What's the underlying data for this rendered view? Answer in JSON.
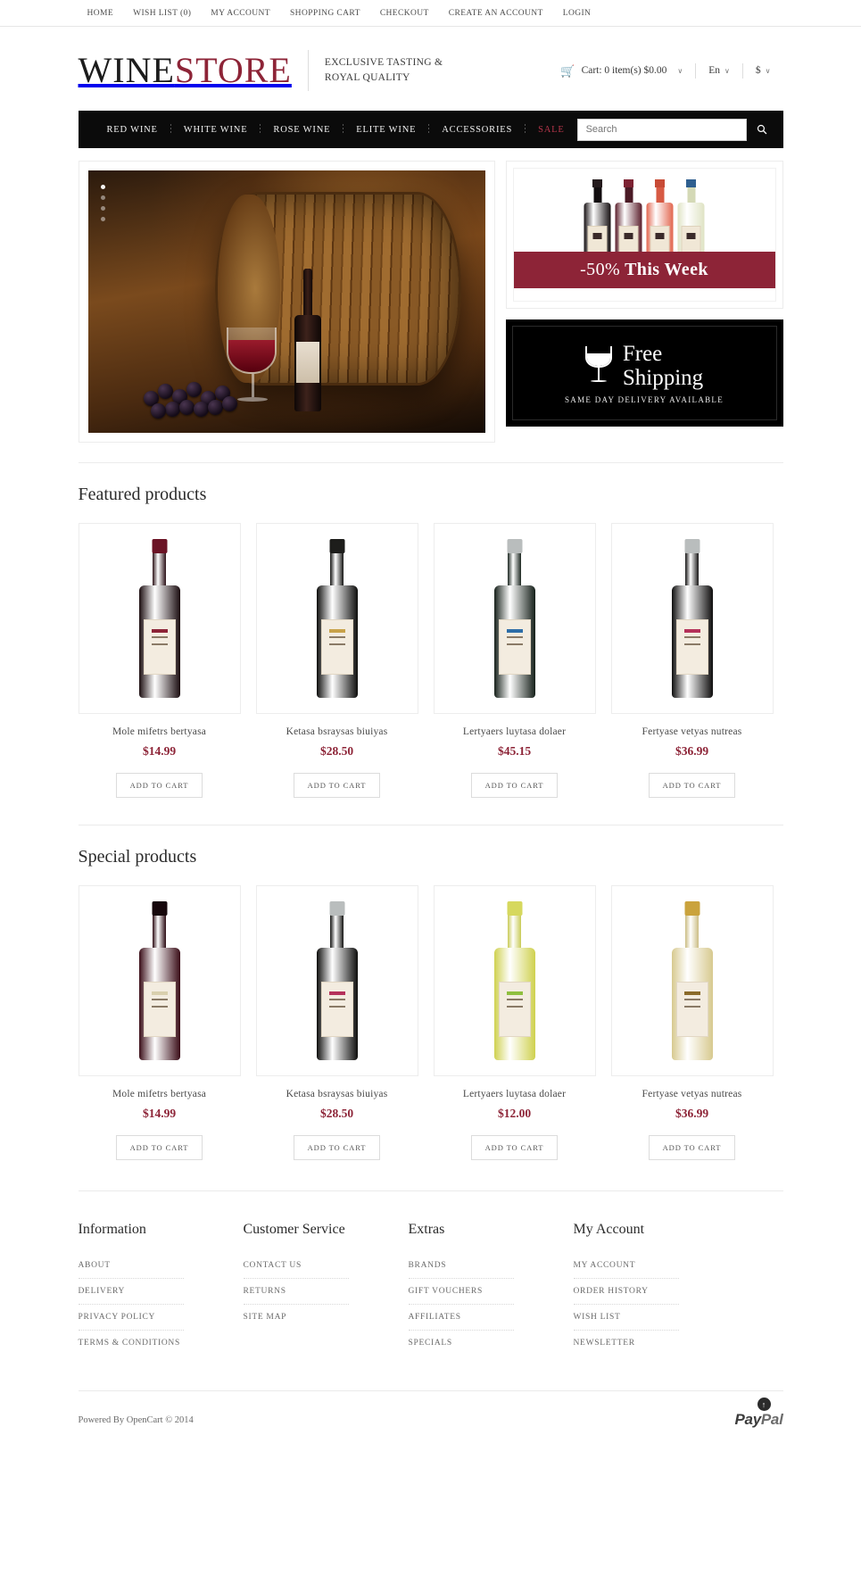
{
  "topnav": {
    "items": [
      {
        "label": "HOME",
        "name": "topnav-home"
      },
      {
        "label": "WISH LIST (0)",
        "name": "topnav-wish-list"
      },
      {
        "label": "MY ACCOUNT",
        "name": "topnav-my-account"
      },
      {
        "label": "SHOPPING CART",
        "name": "topnav-shopping-cart"
      },
      {
        "label": "CHECKOUT",
        "name": "topnav-checkout"
      },
      {
        "label": "CREATE AN ACCOUNT",
        "name": "topnav-create-an-account"
      },
      {
        "label": "LOGIN",
        "name": "topnav-login"
      }
    ]
  },
  "header": {
    "logo_part1": "WINE",
    "logo_part2": "STORE",
    "tagline_line1": "EXCLUSIVE TASTING &",
    "tagline_line2": "ROYAL QUALITY",
    "cart_text": "Cart: 0 item(s) $0.00",
    "cart_icon": "cart-icon",
    "language": "En",
    "currency": "$",
    "caret": "∨"
  },
  "nav": {
    "items": [
      {
        "label": "RED WINE",
        "name": "nav-red-wine",
        "sale": false
      },
      {
        "label": "WHITE WINE",
        "name": "nav-white-wine",
        "sale": false
      },
      {
        "label": "ROSE WINE",
        "name": "nav-rose-wine",
        "sale": false
      },
      {
        "label": "ELITE WINE",
        "name": "nav-elite-wine",
        "sale": false
      },
      {
        "label": "ACCESSORIES",
        "name": "nav-accessories",
        "sale": false
      },
      {
        "label": "SALE",
        "name": "nav-sale",
        "sale": true
      }
    ],
    "search_placeholder": "Search",
    "search_value": "",
    "search_icon": "search-icon"
  },
  "hero": {
    "slide_alt": "wine barrel with glass and bottle",
    "dots": 4,
    "active_dot": 0
  },
  "banners": {
    "promo": {
      "discount": "-50%",
      "text": " This Week"
    },
    "shipping": {
      "line1": "Free",
      "line2": "Shipping",
      "sub": "SAME DAY DELIVERY AVAILABLE",
      "icon": "wine-glass-icon"
    }
  },
  "featured": {
    "title": "Featured products",
    "add_to_cart": "ADD TO CART",
    "products": [
      {
        "name": "Mole mifetrs bertyasa",
        "price": "$14.99",
        "body": "#1b0d10",
        "neck": "#2a1016",
        "cap": "#6b1325",
        "label_band": "#8d2437"
      },
      {
        "name": "Ketasa bsraysas biuiyas",
        "price": "$28.50",
        "body": "#0d0d0c",
        "neck": "#141413",
        "cap": "#1d1d1b",
        "label_band": "#c8a24a"
      },
      {
        "name": "Lertyaers luytasa dolaer",
        "price": "$45.15",
        "body": "#16201a",
        "neck": "#1b2620",
        "cap": "#b9bdbd",
        "label_band": "#2e6ea8"
      },
      {
        "name": "Fertyase vetyas nutreas",
        "price": "$36.99",
        "body": "#0e0d0d",
        "neck": "#151414",
        "cap": "#b9bdbd",
        "label_band": "#b5315a"
      }
    ]
  },
  "special": {
    "title": "Special products",
    "add_to_cart": "ADD TO CART",
    "products": [
      {
        "name": "Mole mifetrs bertyasa",
        "price": "$14.99",
        "body": "#3a0d18",
        "neck": "#2a0a12",
        "cap": "#17080c",
        "label_band": "#d9cfae"
      },
      {
        "name": "Ketasa bsraysas biuiyas",
        "price": "$28.50",
        "body": "#0d0d0c",
        "neck": "#141413",
        "cap": "#b9bdbd",
        "label_band": "#b5315a"
      },
      {
        "name": "Lertyaers luytasa dolaer",
        "price": "$12.00",
        "body": "#cfd14f",
        "neck": "#c9cb57",
        "cap": "#d6d85e",
        "label_band": "#8fbf3f"
      },
      {
        "name": "Fertyase vetyas nutreas",
        "price": "$36.99",
        "body": "#d7c98f",
        "neck": "#cbbd83",
        "cap": "#caa33d",
        "label_band": "#8a6a2a"
      }
    ]
  },
  "footer": {
    "columns": [
      {
        "title": "Information",
        "name": "footer-column-information",
        "links": [
          "ABOUT",
          "DELIVERY",
          "PRIVACY POLICY",
          "TERMS & CONDITIONS"
        ]
      },
      {
        "title": "Customer Service",
        "name": "footer-column-customer-service",
        "links": [
          "CONTACT US",
          "RETURNS",
          "SITE MAP"
        ]
      },
      {
        "title": "Extras",
        "name": "footer-column-extras",
        "links": [
          "BRANDS",
          "GIFT VOUCHERS",
          "AFFILIATES",
          "SPECIALS"
        ]
      },
      {
        "title": "My Account",
        "name": "footer-column-my-account",
        "links": [
          "MY ACCOUNT",
          "ORDER HISTORY",
          "WISH LIST",
          "NEWSLETTER"
        ]
      }
    ],
    "copyright": "Powered By OpenCart © 2014",
    "paypal_part1": "Pay",
    "paypal_part2": "Pal",
    "back_to_top_icon": "arrow-up-icon"
  },
  "colors": {
    "accent": "#8d2437",
    "nav_bg": "#0b0b0b",
    "text": "#4a4a4a"
  }
}
